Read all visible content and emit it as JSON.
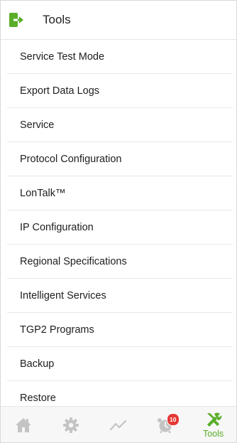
{
  "header": {
    "title": "Tools",
    "icon": "exit-arrow-icon",
    "accent_color": "#5aae2a"
  },
  "menu": {
    "items": [
      {
        "label": "Service Test Mode"
      },
      {
        "label": "Export Data Logs"
      },
      {
        "label": "Service"
      },
      {
        "label": "Protocol Configuration"
      },
      {
        "label": "LonTalk™"
      },
      {
        "label": "IP Configuration"
      },
      {
        "label": "Regional Specifications"
      },
      {
        "label": "Intelligent Services"
      },
      {
        "label": "TGP2 Programs"
      },
      {
        "label": "Backup"
      },
      {
        "label": "Restore"
      }
    ]
  },
  "tabbar": {
    "tabs": [
      {
        "icon": "home-icon",
        "active": false
      },
      {
        "icon": "gear-icon",
        "active": false
      },
      {
        "icon": "trend-icon",
        "active": false
      },
      {
        "icon": "alarm-clock-icon",
        "badge": "10",
        "active": false
      },
      {
        "icon": "tools-icon",
        "label": "Tools",
        "active": true
      }
    ],
    "inactive_color": "#c4c4c4",
    "active_color": "#5aae2a",
    "badge_color": "#e53935"
  }
}
